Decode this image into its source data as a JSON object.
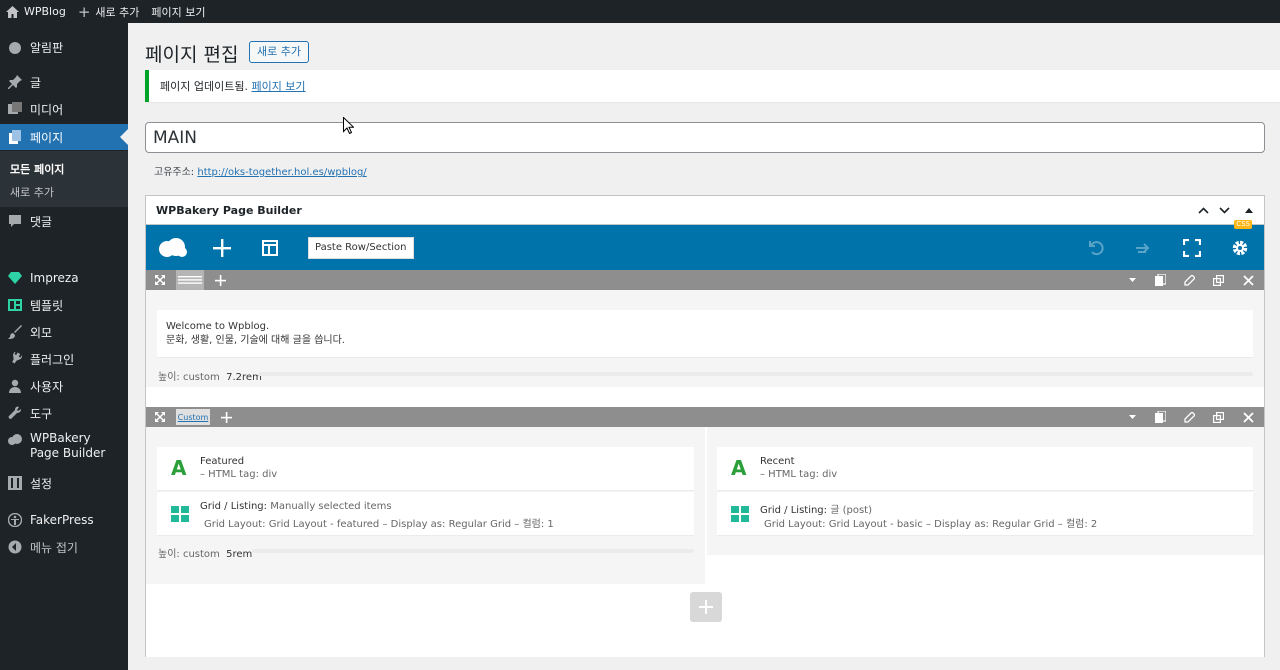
{
  "adminbar": {
    "site_name": "WPBlog",
    "new_label": "새로 추가",
    "view_page": "페이지 보기"
  },
  "sidebar": {
    "items": [
      {
        "label": "알림판",
        "icon": "dashboard-icon"
      },
      {
        "label": "글",
        "icon": "pin-icon"
      },
      {
        "label": "미디어",
        "icon": "media-icon"
      },
      {
        "label": "페이지",
        "icon": "pages-icon",
        "active": true
      },
      {
        "label": "댓글",
        "icon": "comment-icon"
      },
      {
        "label": "Impreza",
        "icon": "diamond-icon"
      },
      {
        "label": "템플릿",
        "icon": "template-icon"
      },
      {
        "label": "외모",
        "icon": "brush-icon"
      },
      {
        "label": "플러그인",
        "icon": "plugin-icon"
      },
      {
        "label": "사용자",
        "icon": "user-icon"
      },
      {
        "label": "도구",
        "icon": "wrench-icon"
      },
      {
        "label": "WPBakery Page Builder",
        "icon": "cloud-icon"
      },
      {
        "label": "설정",
        "icon": "settings-icon"
      },
      {
        "label": "FakerPress",
        "icon": "accessibility-icon"
      },
      {
        "label": "메뉴 접기",
        "icon": "collapse-icon"
      }
    ],
    "submenu": {
      "all_pages": "모든 페이지",
      "add_new": "새로 추가"
    }
  },
  "main": {
    "page_title": "페이지 편집",
    "add_new_button": "새로 추가",
    "notice_text": "페이지 업데이트됨.",
    "notice_link": "페이지 보기",
    "title_value": "MAIN",
    "permalink_label": "고유주소:",
    "permalink_url": "http://oks-together.hol.es/wpblog/"
  },
  "builder": {
    "title": "WPBakery Page Builder",
    "paste_button": "Paste Row/Section",
    "css_badge": "CSS",
    "accent": "#0073aa",
    "row1": {
      "text_line1": "Welcome to Wpblog.",
      "text_line2": "문화, 생활, 인물, 기술에 대해 글을 씁니다.",
      "height_label": "높이: custom",
      "height_value": "7.2rem"
    },
    "row2": {
      "custom_label": "Custom",
      "col1": {
        "heading_title": "Featured",
        "heading_sub": "– HTML tag: div",
        "grid_title": "Grid / Listing:",
        "grid_title_value": "Manually selected items",
        "grid_sub": "Grid Layout: Grid Layout - featured – Display as: Regular Grid – 컬럼: 1",
        "height_label": "높이: custom",
        "height_value": "5rem"
      },
      "col2": {
        "heading_title": "Recent",
        "heading_sub": "– HTML tag: div",
        "grid_title": "Grid / Listing:",
        "grid_title_value": "글 (post)",
        "grid_sub": "Grid Layout: Grid Layout - basic – Display as: Regular Grid – 컬럼: 2"
      }
    }
  }
}
